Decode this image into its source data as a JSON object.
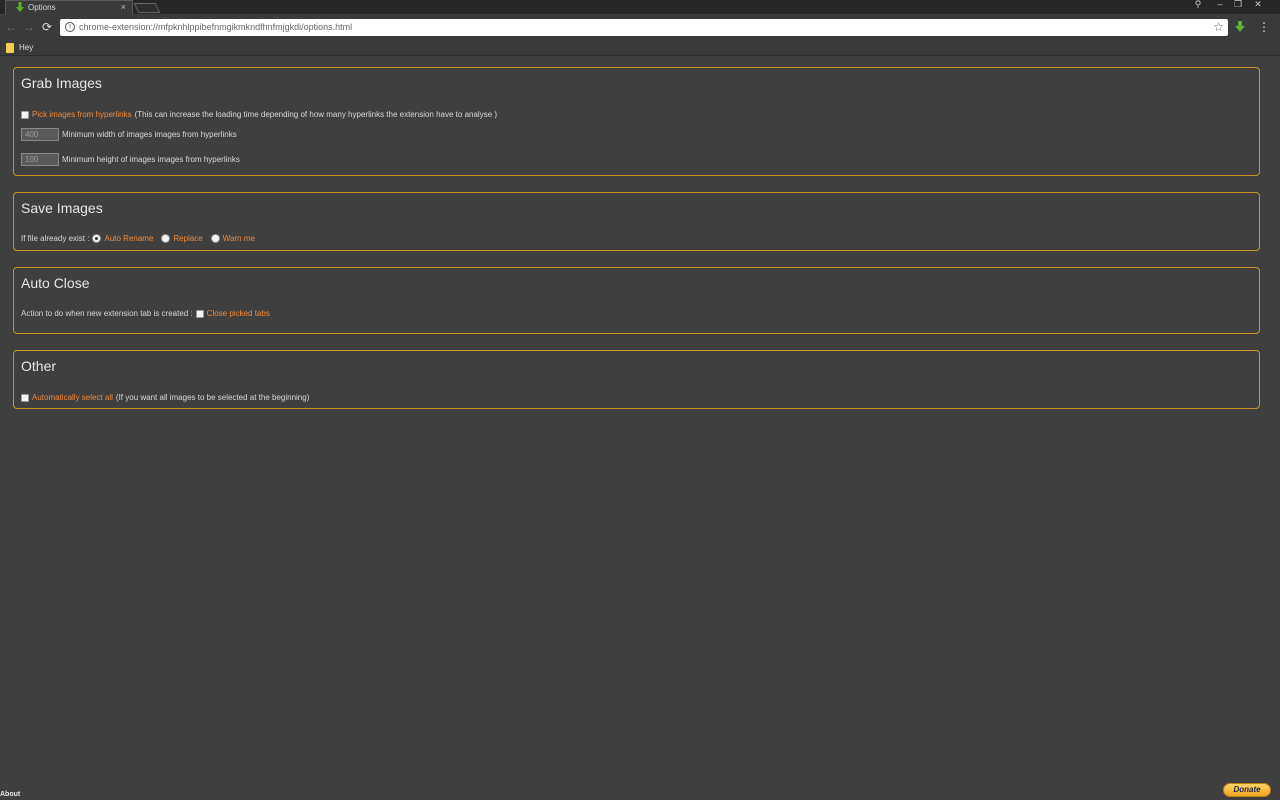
{
  "browser": {
    "tab_title": "Options",
    "tab_close": "×",
    "url": "chrome-extension://mfpknhlppibefnmgikmkndfhnfmjgkdi/options.html",
    "bookmark_label": "Hey",
    "window_controls": {
      "user": "⚲",
      "minimize": "–",
      "maximize": "❐",
      "close": "✕"
    },
    "nav": {
      "back": "←",
      "forward": "→",
      "reload": "⟳",
      "info": "i",
      "star": "☆",
      "menu": "⋮"
    }
  },
  "grab_images": {
    "title": "Grab Images",
    "pick_label": "Pick images from hyperlinks",
    "pick_note": "(This can increase the loading time depending of how many hyperlinks the extension have to analyse )",
    "min_width_value": "400",
    "min_width_label": "Minimum width of images images from hyperlinks",
    "min_height_value": "100",
    "min_height_label": "Minimum height of images images from hyperlinks"
  },
  "save_images": {
    "title": "Save Images",
    "prompt": "If file already exist :",
    "options": [
      "Auto Rename",
      "Replace",
      "Warn me"
    ],
    "selected": "Auto Rename"
  },
  "auto_close": {
    "title": "Auto Close",
    "prompt": "Action to do when new extension tab is created :",
    "option": "Close picked tabs"
  },
  "other": {
    "title": "Other",
    "select_all_label": "Automatically select all",
    "select_all_note": "(If you want all images to be selected at the beginning)"
  },
  "footer": {
    "about": "About",
    "donate": "Donate"
  },
  "colors": {
    "accent": "#f08a3c",
    "border": "#c8962a",
    "background": "#3f3f3f"
  }
}
